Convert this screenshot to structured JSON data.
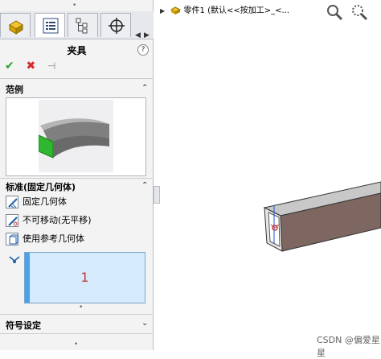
{
  "panel": {
    "title": "夹具",
    "help_label": "?",
    "sections": {
      "example": {
        "title": "范例"
      },
      "standard": {
        "title": "标准(固定几何体)",
        "items": [
          {
            "label": "固定几何体"
          },
          {
            "label": "不可移动(无平移)"
          },
          {
            "label": "使用参考几何体"
          }
        ],
        "selection_count": "1"
      },
      "symbol": {
        "title": "符号设定"
      }
    }
  },
  "viewport": {
    "tree_label": "零件1 (默认<<按加工>_<..."
  },
  "watermark": "CSDN @偏爱星星",
  "colors": {
    "accent": "#4aa3e8",
    "selection_bg": "#d5ebfb",
    "ok": "#2ca02c",
    "cancel": "#d62728"
  }
}
